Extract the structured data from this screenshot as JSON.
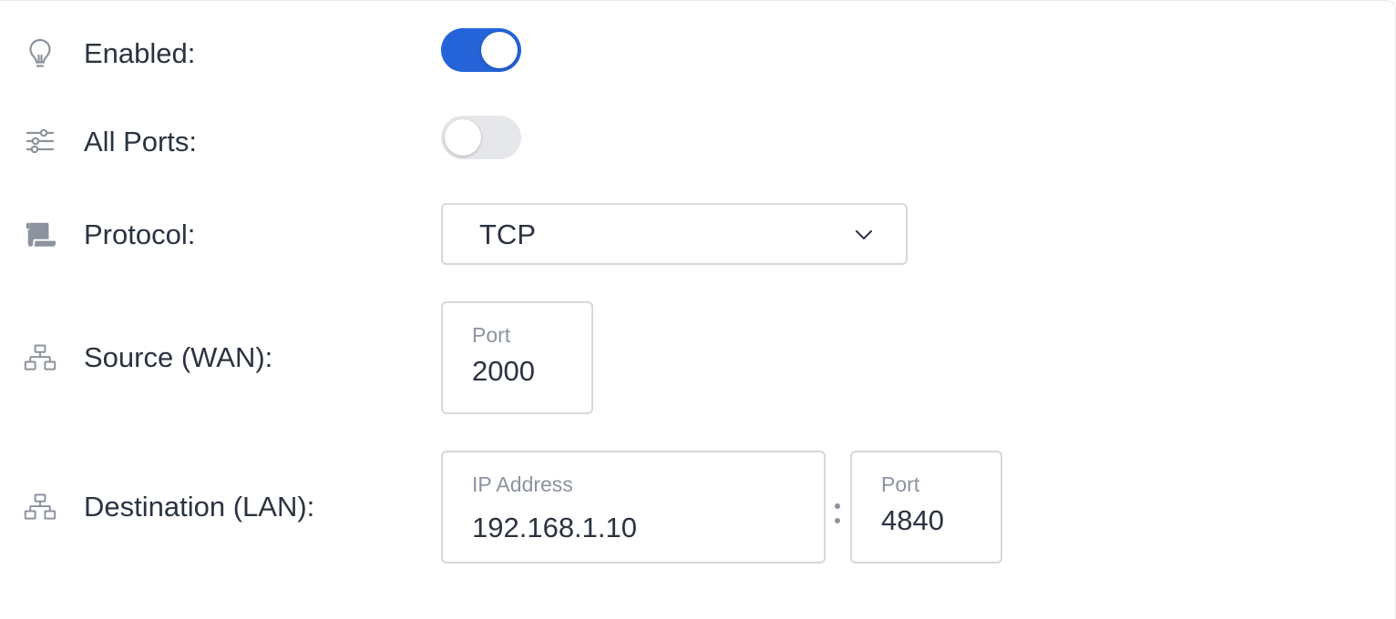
{
  "rows": {
    "enabled": {
      "label": "Enabled:",
      "icon": "lightbulb-icon",
      "value": true
    },
    "all_ports": {
      "label": "All Ports:",
      "icon": "sliders-icon",
      "value": false
    },
    "protocol": {
      "label": "Protocol:",
      "icon": "scroll-icon",
      "selected": "TCP"
    },
    "source": {
      "label": "Source (WAN):",
      "icon": "network-icon",
      "port_label": "Port",
      "port_value": "2000"
    },
    "destination": {
      "label": "Destination (LAN):",
      "icon": "network-icon",
      "ip_label": "IP Address",
      "ip_value": "192.168.1.10",
      "port_label": "Port",
      "port_value": "4840"
    }
  },
  "colors": {
    "toggle_on": "#2563d8",
    "toggle_off": "#e6e7ea",
    "text": "#2b3340",
    "muted": "#8c939e",
    "border": "#d4d7dc"
  }
}
